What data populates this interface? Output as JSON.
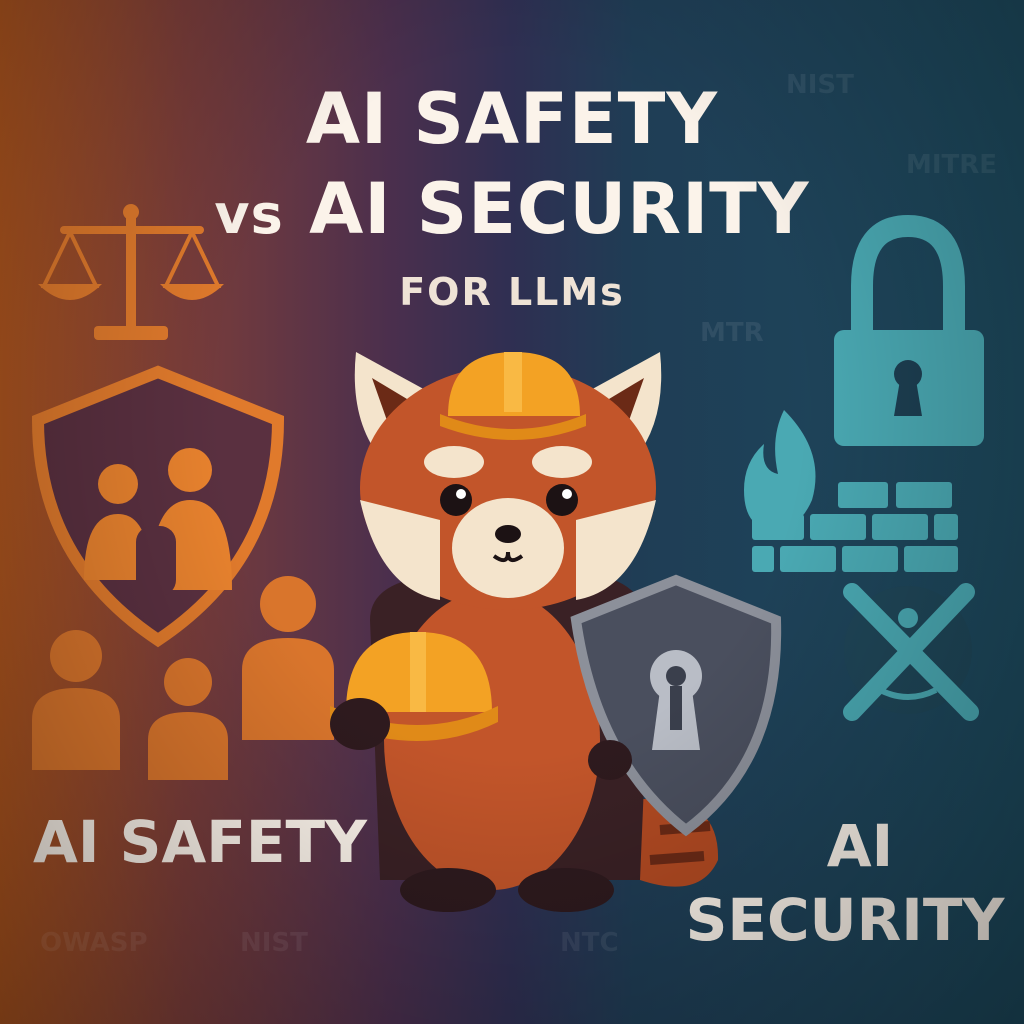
{
  "title": {
    "line1": "AI SAFETY",
    "vs": "vs",
    "line2": "AI SECURITY",
    "subtitle": "FOR LLMs"
  },
  "labels": {
    "left": "AI SAFETY",
    "right_line1": "AI",
    "right_line2": "SECURITY"
  },
  "background_marks": [
    "NIST",
    "MITRE",
    "MTR",
    "OWASP",
    "NIST",
    "NTC"
  ],
  "icons": {
    "left": [
      "scales-icon",
      "shield-people-icon",
      "people-group-icon"
    ],
    "right": [
      "padlock-icon",
      "firewall-icon",
      "cross-icon"
    ],
    "center": [
      "red-panda-mascot",
      "hard-hat-icon",
      "keyhole-shield-icon"
    ]
  },
  "colors": {
    "safety_orange": "#e8822e",
    "security_teal": "#4aa9b3",
    "panda_red": "#c2552a",
    "shield_gray": "#5d6270"
  }
}
